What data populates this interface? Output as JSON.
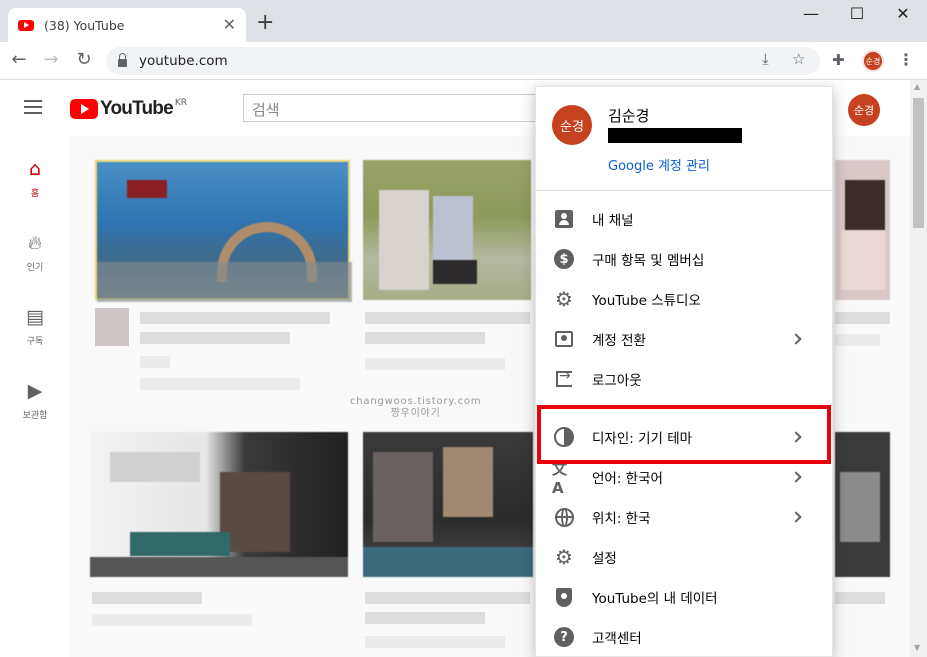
{
  "browser": {
    "tab_title": "(38) YouTube",
    "tab_close": "✕",
    "new_tab": "+",
    "url": "youtube.com",
    "minimize": "—",
    "maximize": "☐",
    "close": "✕",
    "profile_initials": "순경"
  },
  "header": {
    "logo_text": "YouTube",
    "region": "KR",
    "search_placeholder": "검색",
    "avatar_initials": "순경"
  },
  "guide": {
    "items": [
      {
        "label": "홈",
        "icon": "home-icon",
        "glyph": "⌂"
      },
      {
        "label": "인기",
        "icon": "fire-icon",
        "glyph": "🔥︎"
      },
      {
        "label": "구독",
        "icon": "subscriptions-icon",
        "glyph": "▤"
      },
      {
        "label": "보관함",
        "icon": "library-icon",
        "glyph": "▶"
      }
    ]
  },
  "watermark": {
    "line1": "changwoos.tistory.com",
    "line2": "쨩우이야기"
  },
  "account_menu": {
    "avatar_initials": "순경",
    "username": "김순경",
    "manage_link": "Google 계정 관리",
    "items": [
      {
        "label": "내 채널",
        "icon": "person-icon"
      },
      {
        "label": "구매 항목 및 멤버십",
        "icon": "dollar-icon"
      },
      {
        "label": "YouTube 스튜디오",
        "icon": "gear-icon"
      },
      {
        "label": "계정 전환",
        "icon": "switch-account-icon"
      },
      {
        "label": "로그아웃",
        "icon": "logout-icon"
      },
      {
        "label": "디자인: 기기 테마",
        "icon": "theme-icon"
      },
      {
        "label": "언어: 한국어",
        "icon": "translate-icon"
      },
      {
        "label": "위치: 한국",
        "icon": "globe-icon"
      },
      {
        "label": "설정",
        "icon": "settings-icon"
      },
      {
        "label": "YouTube의 내 데이터",
        "icon": "shield-icon"
      },
      {
        "label": "고객센터",
        "icon": "help-icon"
      }
    ]
  },
  "colors": {
    "yt_red": "#ff0000",
    "highlight": "#e8000b",
    "link_blue": "#065fd4",
    "avatar": "#c5411f"
  }
}
